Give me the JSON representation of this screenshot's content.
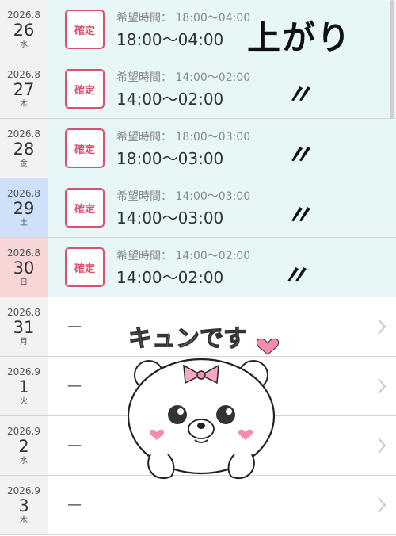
{
  "labels": {
    "confirmed": "確定",
    "hope_prefix": "希望時間： "
  },
  "rows": [
    {
      "ym": "2026.8",
      "day": "26",
      "weekday": "水",
      "status": "confirmed",
      "hope": "18:00〜04:00",
      "time": "18:00〜04:00",
      "day_type": "weekday"
    },
    {
      "ym": "2026.8",
      "day": "27",
      "weekday": "木",
      "status": "confirmed",
      "hope": "14:00〜02:00",
      "time": "14:00〜02:00",
      "day_type": "weekday"
    },
    {
      "ym": "2026.8",
      "day": "28",
      "weekday": "金",
      "status": "confirmed",
      "hope": "18:00〜03:00",
      "time": "18:00〜03:00",
      "day_type": "weekday"
    },
    {
      "ym": "2026.8",
      "day": "29",
      "weekday": "土",
      "status": "confirmed",
      "hope": "14:00〜03:00",
      "time": "14:00〜03:00",
      "day_type": "saturday"
    },
    {
      "ym": "2026.8",
      "day": "30",
      "weekday": "日",
      "status": "confirmed",
      "hope": "14:00〜02:00",
      "time": "14:00〜02:00",
      "day_type": "sunday"
    },
    {
      "ym": "2026.8",
      "day": "31",
      "weekday": "月",
      "status": "empty",
      "dash": "—",
      "day_type": "weekday"
    },
    {
      "ym": "2026.9",
      "day": "1",
      "weekday": "火",
      "status": "empty",
      "dash": "—",
      "day_type": "weekday"
    },
    {
      "ym": "2026.9",
      "day": "2",
      "weekday": "水",
      "status": "empty",
      "dash": "—",
      "day_type": "weekday"
    },
    {
      "ym": "2026.9",
      "day": "3",
      "weekday": "木",
      "status": "empty",
      "dash": "—",
      "day_type": "weekday"
    }
  ],
  "overlay": {
    "agari": "上がり",
    "ditto_marks": [
      "〃",
      "〃",
      "〃",
      "〃"
    ],
    "sticker_text": "キュンです"
  },
  "colors": {
    "confirmed_bg": "#e7f7f8",
    "badge": "#d8516f",
    "saturday": "#cfe0f9",
    "sunday": "#f9d6d6"
  }
}
